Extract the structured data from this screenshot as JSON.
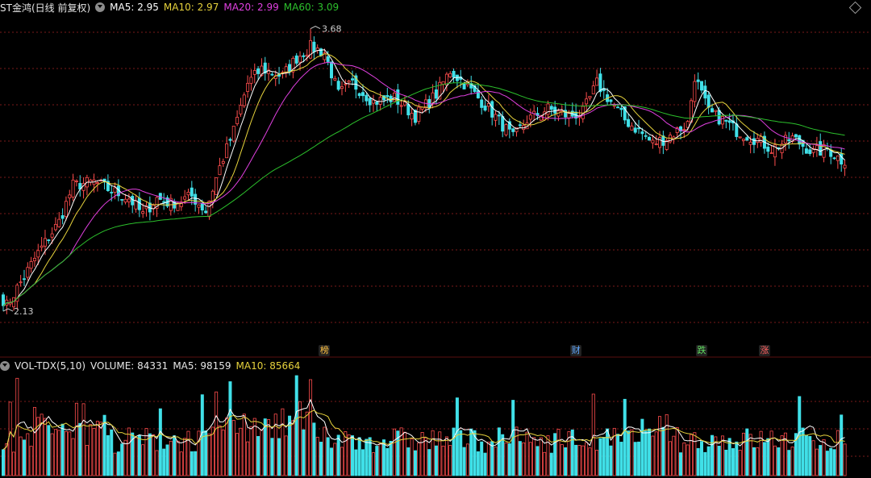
{
  "header": {
    "stock_name": "ST金鸿(日线 前复权)",
    "ma5": "MA5: 2.95",
    "ma10": "MA10: 2.97",
    "ma20": "MA20: 2.99",
    "ma60": "MA60: 3.09"
  },
  "volume_header": {
    "label": "VOL-TDX(5,10)",
    "volume": "VOLUME: 84331",
    "ma5": "MA5: 98159",
    "ma10": "MA10: 85664"
  },
  "colors": {
    "up": "#ff4d4d",
    "down": "#40e0e8",
    "ma5": "#ffffff",
    "ma10": "#e6d23c",
    "ma20": "#e040e0",
    "ma60": "#2cc02c",
    "grid": "#7a1a1a"
  },
  "events": [
    {
      "label": "榜",
      "index": 92,
      "color": "#ffc040"
    },
    {
      "label": "财",
      "index": 164,
      "color": "#60a8ff"
    },
    {
      "label": "跌",
      "index": 200,
      "color": "#60e060"
    },
    {
      "label": "涨",
      "index": 218,
      "color": "#ff6060"
    }
  ],
  "chart_data": {
    "type": "candlestick",
    "price_annotations": {
      "high": "3.68",
      "low": "2.13"
    },
    "anchors": [
      [
        0,
        2.13
      ],
      [
        6,
        2.32
      ],
      [
        10,
        2.45
      ],
      [
        16,
        2.62
      ],
      [
        20,
        2.82
      ],
      [
        26,
        2.84
      ],
      [
        30,
        2.8
      ],
      [
        36,
        2.75
      ],
      [
        40,
        2.66
      ],
      [
        44,
        2.75
      ],
      [
        48,
        2.72
      ],
      [
        54,
        2.76
      ],
      [
        58,
        2.68
      ],
      [
        62,
        2.92
      ],
      [
        66,
        3.12
      ],
      [
        70,
        3.38
      ],
      [
        74,
        3.46
      ],
      [
        80,
        3.42
      ],
      [
        84,
        3.52
      ],
      [
        88,
        3.58
      ],
      [
        92,
        3.55
      ],
      [
        96,
        3.32
      ],
      [
        100,
        3.38
      ],
      [
        106,
        3.28
      ],
      [
        112,
        3.3
      ],
      [
        118,
        3.2
      ],
      [
        124,
        3.32
      ],
      [
        128,
        3.45
      ],
      [
        132,
        3.38
      ],
      [
        136,
        3.3
      ],
      [
        140,
        3.22
      ],
      [
        146,
        3.08
      ],
      [
        150,
        3.18
      ],
      [
        156,
        3.24
      ],
      [
        162,
        3.2
      ],
      [
        166,
        3.22
      ],
      [
        170,
        3.38
      ],
      [
        174,
        3.28
      ],
      [
        178,
        3.18
      ],
      [
        182,
        3.12
      ],
      [
        186,
        3.05
      ],
      [
        190,
        3.08
      ],
      [
        196,
        3.16
      ],
      [
        198,
        3.42
      ],
      [
        202,
        3.22
      ],
      [
        206,
        3.18
      ],
      [
        210,
        3.12
      ],
      [
        216,
        3.07
      ],
      [
        220,
        3.02
      ],
      [
        226,
        3.08
      ],
      [
        232,
        3.0
      ],
      [
        236,
        3.02
      ],
      [
        240,
        2.96
      ]
    ],
    "volume_last": 84331,
    "volume_ma5_last": 98159,
    "volume_ma10_last": 85664
  }
}
